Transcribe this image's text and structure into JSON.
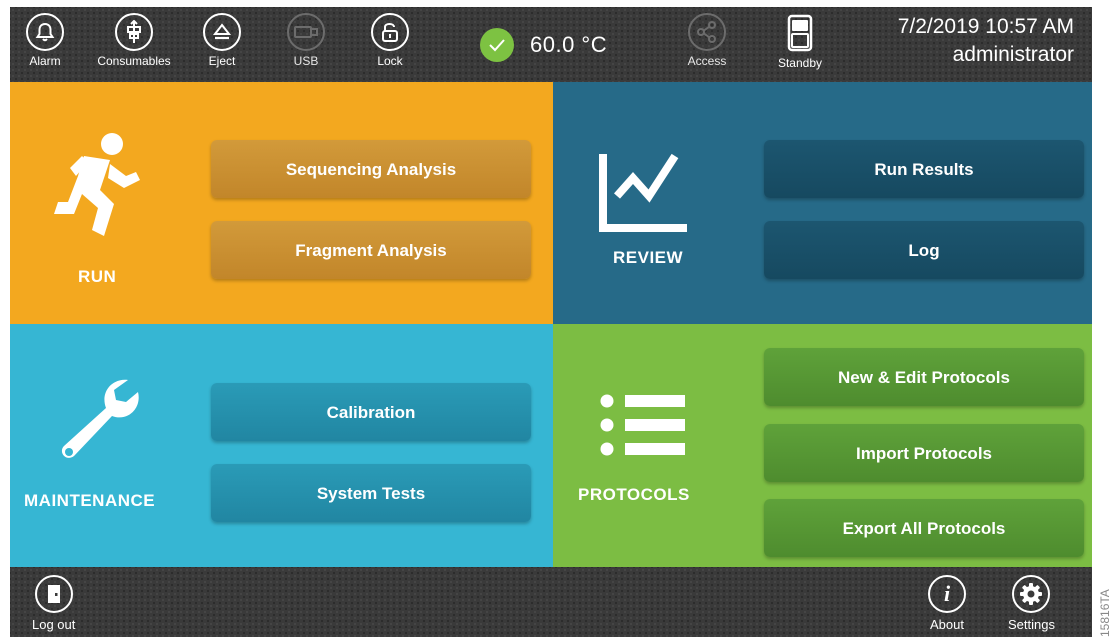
{
  "topbar": {
    "buttons": [
      {
        "label": "Alarm",
        "icon": "bell-icon"
      },
      {
        "label": "Consumables",
        "icon": "cartridge-icon"
      },
      {
        "label": "Eject",
        "icon": "eject-icon"
      },
      {
        "label": "USB",
        "icon": "usb-icon",
        "disabled": true
      },
      {
        "label": "Lock",
        "icon": "unlock-icon"
      },
      {
        "label": "Access",
        "icon": "share-icon",
        "disabled": true
      },
      {
        "label": "Standby",
        "icon": "standby-icon"
      }
    ],
    "temperature": "60.0 °C",
    "temperature_status": "check-icon",
    "date_time": "7/2/2019 10:57 AM",
    "user": "administrator"
  },
  "quadrants": {
    "run": {
      "label": "RUN",
      "icon": "runner-icon",
      "buttons": [
        "Sequencing Analysis",
        "Fragment Analysis"
      ]
    },
    "review": {
      "label": "REVIEW",
      "icon": "line-chart-icon",
      "buttons": [
        "Run Results",
        "Log"
      ]
    },
    "maintenance": {
      "label": "MAINTENANCE",
      "icon": "wrench-icon",
      "buttons": [
        "Calibration",
        "System Tests"
      ]
    },
    "protocols": {
      "label": "PROTOCOLS",
      "icon": "list-icon",
      "buttons": [
        "New & Edit Protocols",
        "Import Protocols",
        "Export All Protocols"
      ]
    }
  },
  "bottombar": {
    "logout": {
      "label": "Log out",
      "icon": "door-icon"
    },
    "about": {
      "label": "About",
      "icon": "info-icon"
    },
    "settings": {
      "label": "Settings",
      "icon": "gear-icon"
    }
  },
  "figure_code": "15816TA",
  "colors": {
    "run": "#f3a81f",
    "review": "#266a88",
    "maintenance": "#36b6d3",
    "protocols": "#7cbd43",
    "status_ok": "#7dc242",
    "bar": "#3a3a3a"
  }
}
